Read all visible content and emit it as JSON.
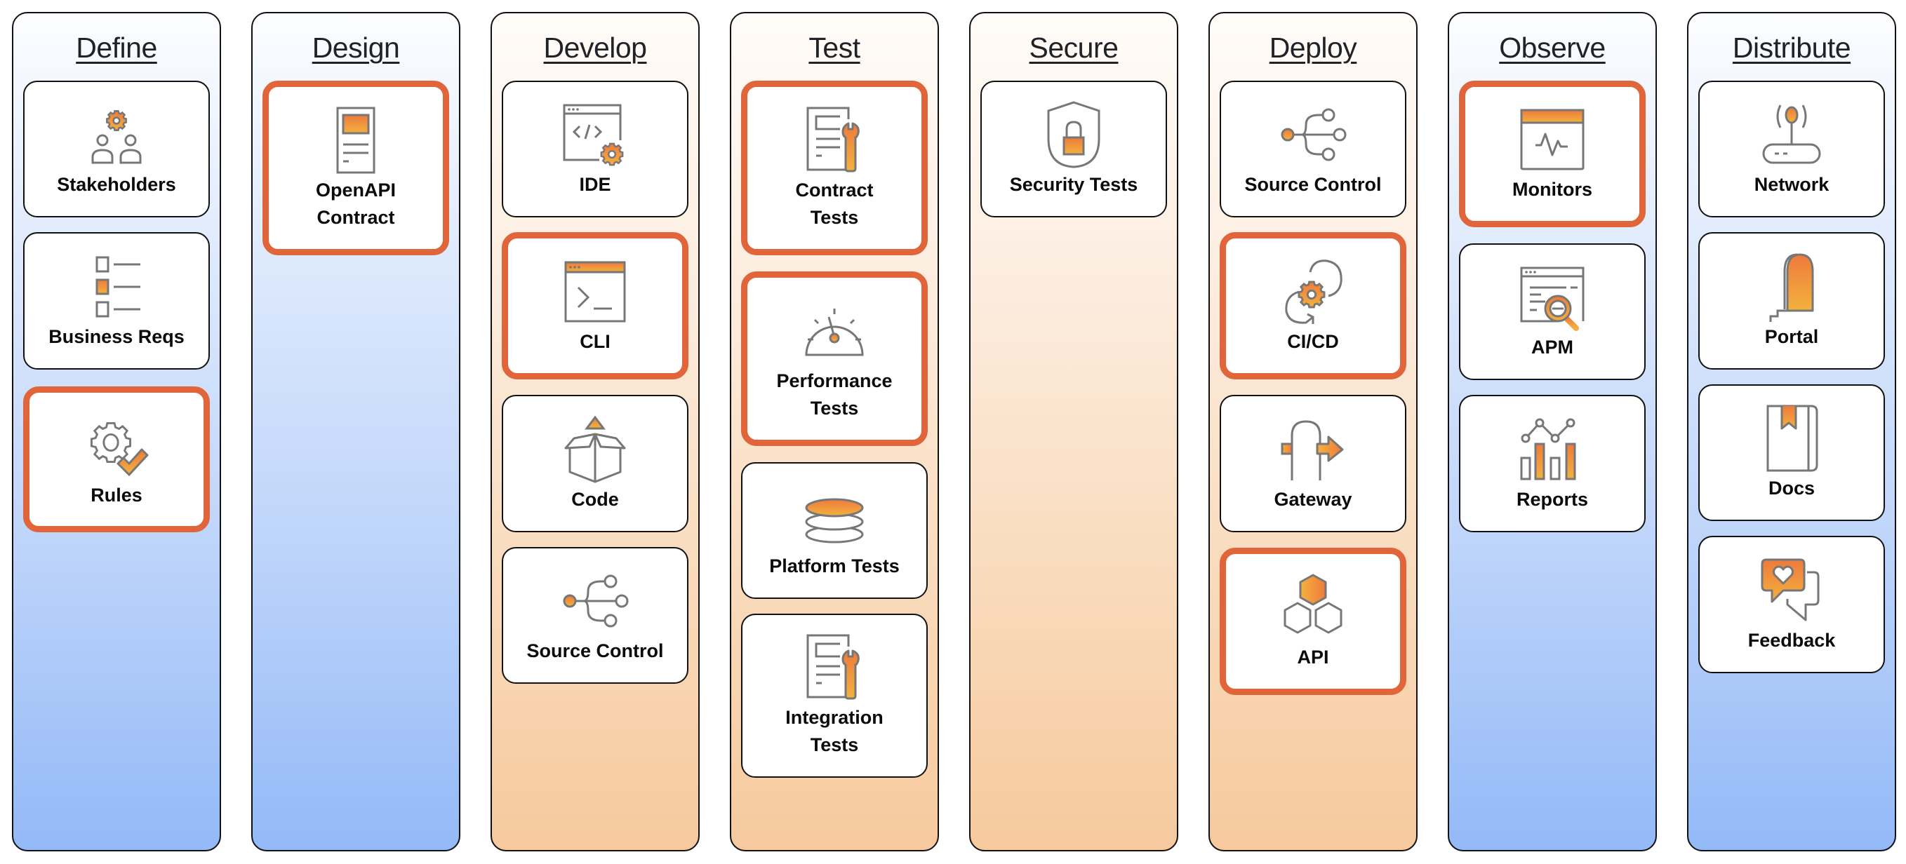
{
  "diagram": {
    "type": "api-lifecycle-stages",
    "colors": {
      "highlight_border": "#e0653a",
      "icon_accent_start": "#ee7a3c",
      "icon_accent_end": "#f3b23e",
      "icon_stroke": "#7a7a7a",
      "blue_column_bottom": "#93b9f7",
      "orange_column_bottom": "#f6c99d"
    },
    "stages": [
      {
        "title": "Define",
        "theme": "blue",
        "items": [
          {
            "label": "Stakeholders",
            "icon": "stakeholders-gear-icon",
            "highlighted": false
          },
          {
            "label": "Business Reqs",
            "icon": "checklist-icon",
            "highlighted": false
          },
          {
            "label": "Rules",
            "icon": "gear-check-icon",
            "highlighted": true
          }
        ]
      },
      {
        "title": "Design",
        "theme": "blue",
        "items": [
          {
            "label": "OpenAPI Contract",
            "icon": "document-icon",
            "highlighted": true
          }
        ]
      },
      {
        "title": "Develop",
        "theme": "orange",
        "items": [
          {
            "label": "IDE",
            "icon": "code-window-gear-icon",
            "highlighted": false
          },
          {
            "label": "CLI",
            "icon": "terminal-icon",
            "highlighted": true
          },
          {
            "label": "Code",
            "icon": "open-box-icon",
            "highlighted": false
          },
          {
            "label": "Source Control",
            "icon": "branch-icon",
            "highlighted": false
          }
        ]
      },
      {
        "title": "Test",
        "theme": "orange",
        "items": [
          {
            "label": "Contract Tests",
            "icon": "document-wrench-icon",
            "highlighted": true
          },
          {
            "label": "Performance Tests",
            "icon": "speedometer-icon",
            "highlighted": true
          },
          {
            "label": "Platform Tests",
            "icon": "stacked-discs-icon",
            "highlighted": false
          },
          {
            "label": "Integration Tests",
            "icon": "document-wrench-icon",
            "highlighted": false
          }
        ]
      },
      {
        "title": "Secure",
        "theme": "orange",
        "items": [
          {
            "label": "Security Tests",
            "icon": "shield-lock-icon",
            "highlighted": false
          }
        ]
      },
      {
        "title": "Deploy",
        "theme": "orange",
        "items": [
          {
            "label": "Source Control",
            "icon": "branch-icon",
            "highlighted": false
          },
          {
            "label": "CI/CD",
            "icon": "gear-cycle-icon",
            "highlighted": true
          },
          {
            "label": "Gateway",
            "icon": "gateway-arrow-icon",
            "highlighted": false
          },
          {
            "label": "API",
            "icon": "hexagons-icon",
            "highlighted": true
          }
        ]
      },
      {
        "title": "Observe",
        "theme": "blue",
        "items": [
          {
            "label": "Monitors",
            "icon": "monitor-pulse-icon",
            "highlighted": true
          },
          {
            "label": "APM",
            "icon": "window-magnifier-icon",
            "highlighted": false
          },
          {
            "label": "Reports",
            "icon": "bar-line-chart-icon",
            "highlighted": false
          }
        ]
      },
      {
        "title": "Distribute",
        "theme": "blue",
        "items": [
          {
            "label": "Network",
            "icon": "router-antenna-icon",
            "highlighted": false
          },
          {
            "label": "Portal",
            "icon": "portal-door-icon",
            "highlighted": false
          },
          {
            "label": "Docs",
            "icon": "bookmarked-book-icon",
            "highlighted": false
          },
          {
            "label": "Feedback",
            "icon": "chat-heart-icon",
            "highlighted": false
          }
        ]
      }
    ]
  }
}
